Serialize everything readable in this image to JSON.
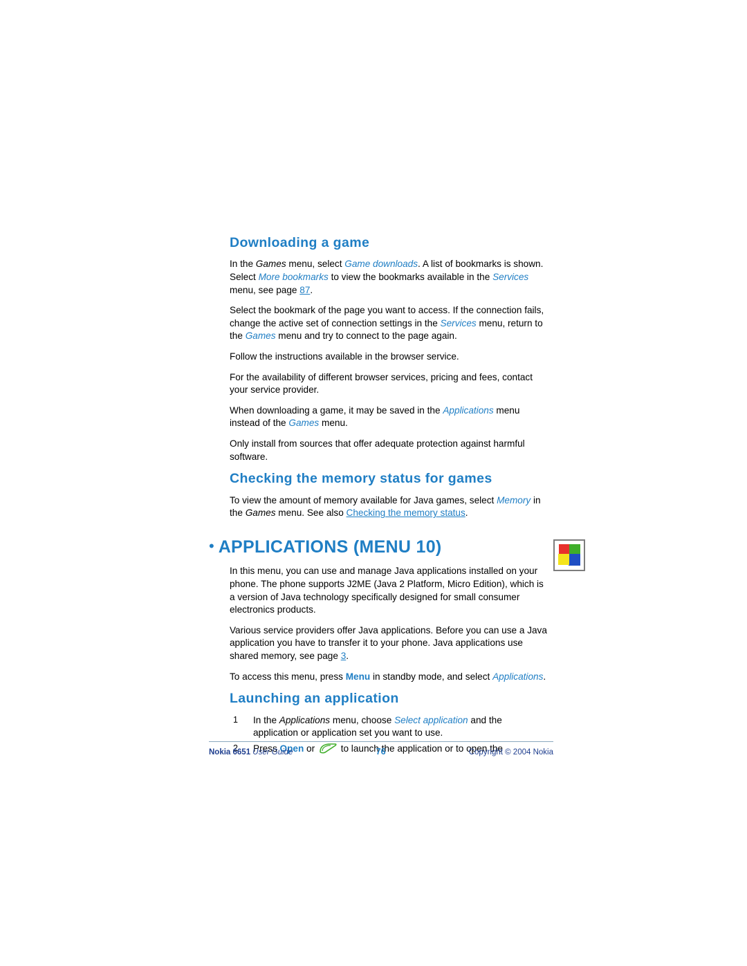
{
  "document": {
    "heading_downloading": "Downloading a game",
    "para1_pre": "In the ",
    "para1_games": "Games",
    "para1_mid1": " menu, select ",
    "para1_gamedownloads": "Game downloads",
    "para1_mid2": ". A list of bookmarks is shown. Select ",
    "para1_morebookmarks": "More bookmarks",
    "para1_mid3": " to view the bookmarks available in the ",
    "para1_services": "Services",
    "para1_mid4": " menu, see page ",
    "para1_page": "87",
    "para1_end": ".",
    "para2_a": "Select the bookmark of the page you want to access. If the connection fails, change the active set of connection settings in the ",
    "para2_services": "Services",
    "para2_b": " menu, return to the ",
    "para2_games": "Games",
    "para2_c": " menu and try to connect to the page again.",
    "para3": "Follow the instructions available in the browser service.",
    "para4": "For the availability of different browser services, pricing and fees, contact your service provider.",
    "para5_a": "When downloading a game, it may be saved in the ",
    "para5_applications": "Applications",
    "para5_b": " menu instead of the ",
    "para5_games": "Games",
    "para5_c": " menu.",
    "para6": "Only install from sources that offer adequate protection against harmful software.",
    "heading_memory": "Checking the memory status for games",
    "para7_a": "To view the amount of memory available for Java games, select ",
    "para7_memory": "Memory",
    "para7_b": " in the ",
    "para7_games": "Games",
    "para7_c": " menu. See also ",
    "para7_link": "Checking the memory status",
    "para7_d": ".",
    "bullet": "•",
    "heading_applications": "APPLICATIONS (MENU 10)",
    "para8": "In this menu, you can use and manage Java applications installed on your phone. The phone supports J2ME (Java 2 Platform, Micro Edition), which is a version of Java technology specifically designed for small consumer electronics products.",
    "para9_a": "Various service providers offer Java applications. Before you can use a Java application you have to transfer it to your phone. Java applications use shared memory, see page ",
    "para9_page": "3",
    "para9_b": ".",
    "para10_a": "To access this menu, press ",
    "para10_menu": "Menu",
    "para10_b": " in standby mode, and select ",
    "para10_applications": "Applications",
    "para10_c": ".",
    "heading_launching": "Launching an application",
    "step1_num": "1",
    "step1_a": "In the ",
    "step1_applications": "Applications",
    "step1_b": " menu, choose ",
    "step1_selectapp": "Select application",
    "step1_c": " and the application or application set you want to use.",
    "step2_num": "2",
    "step2_a": "Press ",
    "step2_open": "Open",
    "step2_b": " or ",
    "step2_c": " to launch the application or to open the",
    "icon_applications": "applications-icon",
    "icon_scroll_key": "scroll-key-icon"
  },
  "footer": {
    "left_model": "Nokia 6651",
    "left_title": " User Guide",
    "page_number": "76",
    "copyright": "Copyright © 2004 Nokia"
  }
}
